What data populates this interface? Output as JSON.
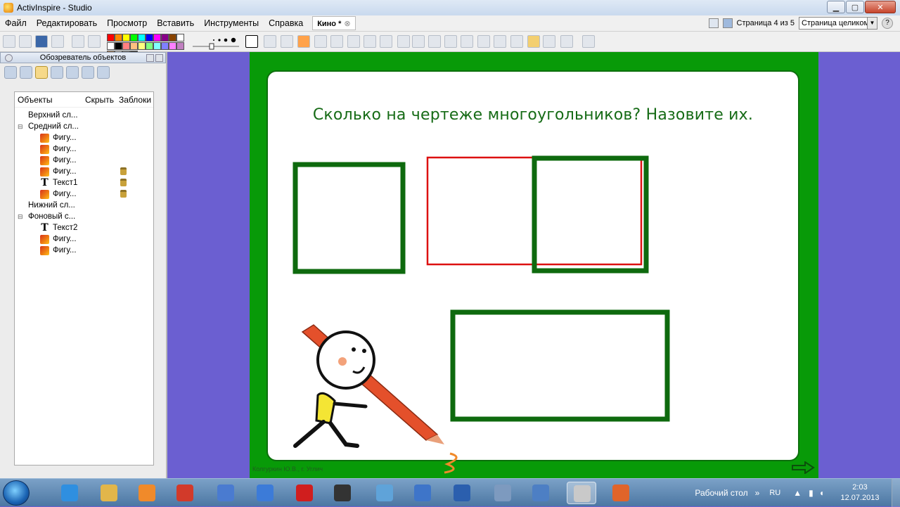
{
  "window": {
    "title": "ActivInspire - Studio",
    "controls": [
      "minimize",
      "maximize",
      "close"
    ]
  },
  "menu": {
    "items": [
      "Файл",
      "Редактировать",
      "Просмотр",
      "Вставить",
      "Инструменты",
      "Справка"
    ],
    "doc_tab": "Кино *",
    "page_indicator": "Страница 4 из 5",
    "zoom_select": "Страница целиком"
  },
  "toolbar": {
    "palette": [
      "#ff0000",
      "#ff8800",
      "#ffff00",
      "#00ff00",
      "#00ffff",
      "#0000ff",
      "#ff00ff",
      "#880088",
      "#884400",
      "#ffffff",
      "#ffffff",
      "#000000",
      "#ff8080",
      "#ffc080",
      "#ffff80",
      "#80ff80",
      "#80ffff",
      "#8080ff",
      "#ff80ff",
      "#c080c0",
      "#a08060",
      "#c0c0c0",
      "#808080",
      "#404040"
    ]
  },
  "explorer": {
    "title": "Обозреватель объектов",
    "columns": [
      "Объекты",
      "Скрыть",
      "Заблоки"
    ],
    "tree": [
      {
        "label": "Верхний сл...",
        "type": "layer",
        "expander": ""
      },
      {
        "label": "Средний сл...",
        "type": "layer",
        "expander": "⊟"
      },
      {
        "label": "Фигу...",
        "type": "shape",
        "locked": false
      },
      {
        "label": "Фигу...",
        "type": "shape",
        "locked": false
      },
      {
        "label": "Фигу...",
        "type": "shape",
        "locked": false
      },
      {
        "label": "Фигу...",
        "type": "shape",
        "locked": true
      },
      {
        "label": "Текст1",
        "type": "text",
        "locked": true
      },
      {
        "label": "Фигу...",
        "type": "shape",
        "locked": true
      },
      {
        "label": "Нижний сл...",
        "type": "layer",
        "expander": ""
      },
      {
        "label": "Фоновый с...",
        "type": "layer",
        "expander": "⊟"
      },
      {
        "label": "Текст2",
        "type": "text",
        "locked": false
      },
      {
        "label": "Фигу...",
        "type": "shape",
        "locked": false
      },
      {
        "label": "Фигу...",
        "type": "shape",
        "locked": false
      }
    ]
  },
  "slide": {
    "question": "Сколько на чертеже многоугольников? Назовите их.",
    "credit": "Колгуркин Ю.В., г. Углич",
    "colors": {
      "frame": "#089a08",
      "shape_green": "#0e6a0e",
      "shape_red": "#dd1111"
    }
  },
  "taskbar": {
    "apps": [
      "ie-icon",
      "explorer-icon",
      "media-icon",
      "yandex-icon",
      "tools-icon",
      "mail-agent-icon",
      "opera-icon",
      "camera-icon",
      "network-icon",
      "audio-icon",
      "word-icon",
      "calculator-icon",
      "outlook-icon",
      "activinspire-icon",
      "firefox-icon"
    ],
    "desktop_label": "Рабочий стол",
    "lang": "RU",
    "time": "2:03",
    "date": "12.07.2013"
  }
}
